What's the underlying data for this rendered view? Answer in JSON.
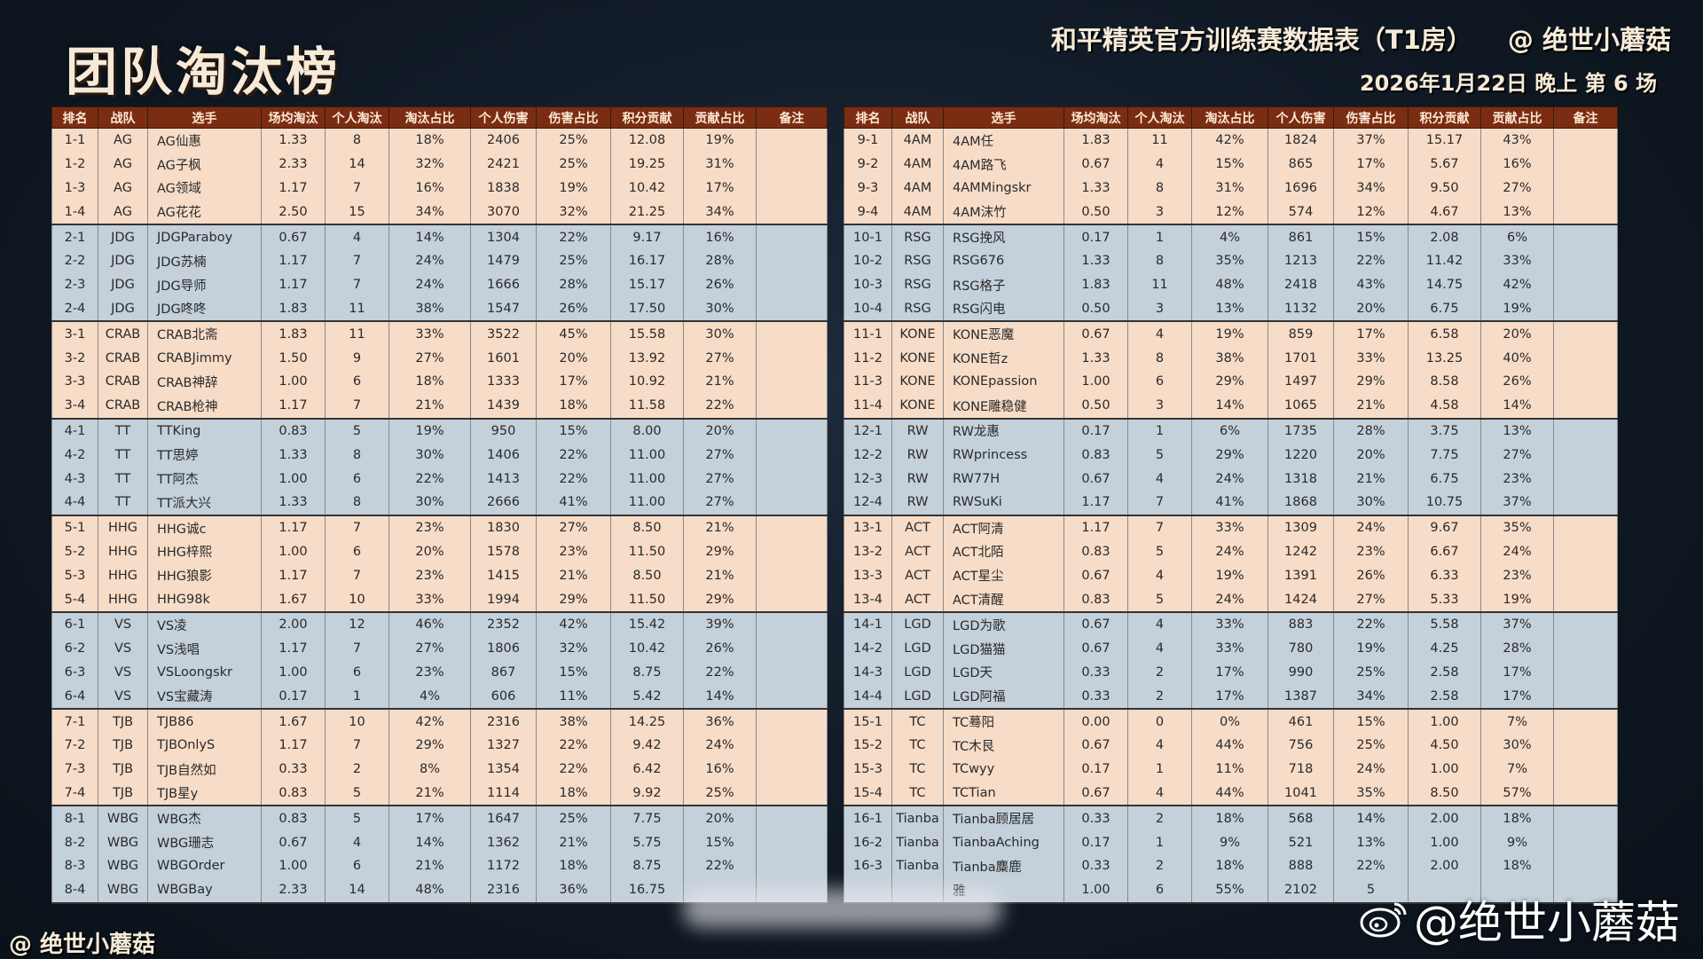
{
  "header": {
    "page_title": "团队淘汰榜",
    "sheet_title": "和平精英官方训练赛数据表（T1房）",
    "handle": "@ 绝世小蘑菇",
    "session_info": "2026年1月22日 晚上 第 6 场"
  },
  "columns": [
    "排名",
    "战队",
    "选手",
    "场均淘汰",
    "个人淘汰",
    "淘汰占比",
    "个人伤害",
    "伤害占比",
    "积分贡献",
    "贡献占比",
    "备注"
  ],
  "left_rows": [
    [
      "1-1",
      "AG",
      "AG仙惠",
      "1.33",
      "8",
      "18%",
      "2406",
      "25%",
      "12.08",
      "19%",
      ""
    ],
    [
      "1-2",
      "AG",
      "AG子枫",
      "2.33",
      "14",
      "32%",
      "2421",
      "25%",
      "19.25",
      "31%",
      ""
    ],
    [
      "1-3",
      "AG",
      "AG领域",
      "1.17",
      "7",
      "16%",
      "1838",
      "19%",
      "10.42",
      "17%",
      ""
    ],
    [
      "1-4",
      "AG",
      "AG花花",
      "2.50",
      "15",
      "34%",
      "3070",
      "32%",
      "21.25",
      "34%",
      ""
    ],
    [
      "2-1",
      "JDG",
      "JDGParaboy",
      "0.67",
      "4",
      "14%",
      "1304",
      "22%",
      "9.17",
      "16%",
      ""
    ],
    [
      "2-2",
      "JDG",
      "JDG苏楠",
      "1.17",
      "7",
      "24%",
      "1479",
      "25%",
      "16.17",
      "28%",
      ""
    ],
    [
      "2-3",
      "JDG",
      "JDG导师",
      "1.17",
      "7",
      "24%",
      "1666",
      "28%",
      "15.17",
      "26%",
      ""
    ],
    [
      "2-4",
      "JDG",
      "JDG咚咚",
      "1.83",
      "11",
      "38%",
      "1547",
      "26%",
      "17.50",
      "30%",
      ""
    ],
    [
      "3-1",
      "CRAB",
      "CRAB北斋",
      "1.83",
      "11",
      "33%",
      "3522",
      "45%",
      "15.58",
      "30%",
      ""
    ],
    [
      "3-2",
      "CRAB",
      "CRABJimmy",
      "1.50",
      "9",
      "27%",
      "1601",
      "20%",
      "13.92",
      "27%",
      ""
    ],
    [
      "3-3",
      "CRAB",
      "CRAB神辞",
      "1.00",
      "6",
      "18%",
      "1333",
      "17%",
      "10.92",
      "21%",
      ""
    ],
    [
      "3-4",
      "CRAB",
      "CRAB枪神",
      "1.17",
      "7",
      "21%",
      "1439",
      "18%",
      "11.58",
      "22%",
      ""
    ],
    [
      "4-1",
      "TT",
      "TTKing",
      "0.83",
      "5",
      "19%",
      "950",
      "15%",
      "8.00",
      "20%",
      ""
    ],
    [
      "4-2",
      "TT",
      "TT思婷",
      "1.33",
      "8",
      "30%",
      "1406",
      "22%",
      "11.00",
      "27%",
      ""
    ],
    [
      "4-3",
      "TT",
      "TT阿杰",
      "1.00",
      "6",
      "22%",
      "1413",
      "22%",
      "11.00",
      "27%",
      ""
    ],
    [
      "4-4",
      "TT",
      "TT派大兴",
      "1.33",
      "8",
      "30%",
      "2666",
      "41%",
      "11.00",
      "27%",
      ""
    ],
    [
      "5-1",
      "HHG",
      "HHG诚c",
      "1.17",
      "7",
      "23%",
      "1830",
      "27%",
      "8.50",
      "21%",
      ""
    ],
    [
      "5-2",
      "HHG",
      "HHG梓熙",
      "1.00",
      "6",
      "20%",
      "1578",
      "23%",
      "11.50",
      "29%",
      ""
    ],
    [
      "5-3",
      "HHG",
      "HHG狼影",
      "1.17",
      "7",
      "23%",
      "1415",
      "21%",
      "8.50",
      "21%",
      ""
    ],
    [
      "5-4",
      "HHG",
      "HHG98k",
      "1.67",
      "10",
      "33%",
      "1994",
      "29%",
      "11.50",
      "29%",
      ""
    ],
    [
      "6-1",
      "VS",
      "VS凌",
      "2.00",
      "12",
      "46%",
      "2352",
      "42%",
      "15.42",
      "39%",
      ""
    ],
    [
      "6-2",
      "VS",
      "VS浅唱",
      "1.17",
      "7",
      "27%",
      "1806",
      "32%",
      "10.42",
      "26%",
      ""
    ],
    [
      "6-3",
      "VS",
      "VSLoongskr",
      "1.00",
      "6",
      "23%",
      "867",
      "15%",
      "8.75",
      "22%",
      ""
    ],
    [
      "6-4",
      "VS",
      "VS宝藏涛",
      "0.17",
      "1",
      "4%",
      "606",
      "11%",
      "5.42",
      "14%",
      ""
    ],
    [
      "7-1",
      "TJB",
      "TJB86",
      "1.67",
      "10",
      "42%",
      "2316",
      "38%",
      "14.25",
      "36%",
      ""
    ],
    [
      "7-2",
      "TJB",
      "TJBOnlyS",
      "1.17",
      "7",
      "29%",
      "1327",
      "22%",
      "9.42",
      "24%",
      ""
    ],
    [
      "7-3",
      "TJB",
      "TJB自然如",
      "0.33",
      "2",
      "8%",
      "1354",
      "22%",
      "6.42",
      "16%",
      ""
    ],
    [
      "7-4",
      "TJB",
      "TJB星y",
      "0.83",
      "5",
      "21%",
      "1114",
      "18%",
      "9.92",
      "25%",
      ""
    ],
    [
      "8-1",
      "WBG",
      "WBG杰",
      "0.83",
      "5",
      "17%",
      "1647",
      "25%",
      "7.75",
      "20%",
      ""
    ],
    [
      "8-2",
      "WBG",
      "WBG珊志",
      "0.67",
      "4",
      "14%",
      "1362",
      "21%",
      "5.75",
      "15%",
      ""
    ],
    [
      "8-3",
      "WBG",
      "WBGOrder",
      "1.00",
      "6",
      "21%",
      "1172",
      "18%",
      "8.75",
      "22%",
      ""
    ],
    [
      "8-4",
      "WBG",
      "WBGBay",
      "2.33",
      "14",
      "48%",
      "2316",
      "36%",
      "16.75",
      "",
      ""
    ]
  ],
  "right_rows": [
    [
      "9-1",
      "4AM",
      "4AM任",
      "1.83",
      "11",
      "42%",
      "1824",
      "37%",
      "15.17",
      "43%",
      ""
    ],
    [
      "9-2",
      "4AM",
      "4AM路飞",
      "0.67",
      "4",
      "15%",
      "865",
      "17%",
      "5.67",
      "16%",
      ""
    ],
    [
      "9-3",
      "4AM",
      "4AMMingskr",
      "1.33",
      "8",
      "31%",
      "1696",
      "34%",
      "9.50",
      "27%",
      ""
    ],
    [
      "9-4",
      "4AM",
      "4AM沫竹",
      "0.50",
      "3",
      "12%",
      "574",
      "12%",
      "4.67",
      "13%",
      ""
    ],
    [
      "10-1",
      "RSG",
      "RSG挽风",
      "0.17",
      "1",
      "4%",
      "861",
      "15%",
      "2.08",
      "6%",
      ""
    ],
    [
      "10-2",
      "RSG",
      "RSG676",
      "1.33",
      "8",
      "35%",
      "1213",
      "22%",
      "11.42",
      "33%",
      ""
    ],
    [
      "10-3",
      "RSG",
      "RSG格子",
      "1.83",
      "11",
      "48%",
      "2418",
      "43%",
      "14.75",
      "42%",
      ""
    ],
    [
      "10-4",
      "RSG",
      "RSG闪电",
      "0.50",
      "3",
      "13%",
      "1132",
      "20%",
      "6.75",
      "19%",
      ""
    ],
    [
      "11-1",
      "KONE",
      "KONE恶魔",
      "0.67",
      "4",
      "19%",
      "859",
      "17%",
      "6.58",
      "20%",
      ""
    ],
    [
      "11-2",
      "KONE",
      "KONE哲z",
      "1.33",
      "8",
      "38%",
      "1701",
      "33%",
      "13.25",
      "40%",
      ""
    ],
    [
      "11-3",
      "KONE",
      "KONEpassion",
      "1.00",
      "6",
      "29%",
      "1497",
      "29%",
      "8.58",
      "26%",
      ""
    ],
    [
      "11-4",
      "KONE",
      "KONE雕稳健",
      "0.50",
      "3",
      "14%",
      "1065",
      "21%",
      "4.58",
      "14%",
      ""
    ],
    [
      "12-1",
      "RW",
      "RW龙惠",
      "0.17",
      "1",
      "6%",
      "1735",
      "28%",
      "3.75",
      "13%",
      ""
    ],
    [
      "12-2",
      "RW",
      "RWprincess",
      "0.83",
      "5",
      "29%",
      "1220",
      "20%",
      "7.75",
      "27%",
      ""
    ],
    [
      "12-3",
      "RW",
      "RW77H",
      "0.67",
      "4",
      "24%",
      "1318",
      "21%",
      "6.75",
      "23%",
      ""
    ],
    [
      "12-4",
      "RW",
      "RWSuKi",
      "1.17",
      "7",
      "41%",
      "1868",
      "30%",
      "10.75",
      "37%",
      ""
    ],
    [
      "13-1",
      "ACT",
      "ACT阿清",
      "1.17",
      "7",
      "33%",
      "1309",
      "24%",
      "9.67",
      "35%",
      ""
    ],
    [
      "13-2",
      "ACT",
      "ACT北陌",
      "0.83",
      "5",
      "24%",
      "1242",
      "23%",
      "6.67",
      "24%",
      ""
    ],
    [
      "13-3",
      "ACT",
      "ACT星尘",
      "0.67",
      "4",
      "19%",
      "1391",
      "26%",
      "6.33",
      "23%",
      ""
    ],
    [
      "13-4",
      "ACT",
      "ACT清醒",
      "0.83",
      "5",
      "24%",
      "1424",
      "27%",
      "5.33",
      "19%",
      ""
    ],
    [
      "14-1",
      "LGD",
      "LGD为歌",
      "0.67",
      "4",
      "33%",
      "883",
      "22%",
      "5.58",
      "37%",
      ""
    ],
    [
      "14-2",
      "LGD",
      "LGD猫猫",
      "0.67",
      "4",
      "33%",
      "780",
      "19%",
      "4.25",
      "28%",
      ""
    ],
    [
      "14-3",
      "LGD",
      "LGD天",
      "0.33",
      "2",
      "17%",
      "990",
      "25%",
      "2.58",
      "17%",
      ""
    ],
    [
      "14-4",
      "LGD",
      "LGD阿福",
      "0.33",
      "2",
      "17%",
      "1387",
      "34%",
      "2.58",
      "17%",
      ""
    ],
    [
      "15-1",
      "TC",
      "TC蓦阳",
      "0.00",
      "0",
      "0%",
      "461",
      "15%",
      "1.00",
      "7%",
      ""
    ],
    [
      "15-2",
      "TC",
      "TC木艮",
      "0.67",
      "4",
      "44%",
      "756",
      "25%",
      "4.50",
      "30%",
      ""
    ],
    [
      "15-3",
      "TC",
      "TCwyy",
      "0.17",
      "1",
      "11%",
      "718",
      "24%",
      "1.00",
      "7%",
      ""
    ],
    [
      "15-4",
      "TC",
      "TCTian",
      "0.67",
      "4",
      "44%",
      "1041",
      "35%",
      "8.50",
      "57%",
      ""
    ],
    [
      "16-1",
      "Tianba",
      "Tianba顾居居",
      "0.33",
      "2",
      "18%",
      "568",
      "14%",
      "2.00",
      "18%",
      ""
    ],
    [
      "16-2",
      "Tianba",
      "TianbaAching",
      "0.17",
      "1",
      "9%",
      "521",
      "13%",
      "1.00",
      "9%",
      ""
    ],
    [
      "16-3",
      "Tianba",
      "Tianba麋鹿",
      "0.33",
      "2",
      "18%",
      "888",
      "22%",
      "2.00",
      "18%",
      ""
    ],
    [
      "",
      "",
      "雅",
      "1.00",
      "6",
      "55%",
      "2102",
      "5",
      "",
      "",
      ""
    ]
  ],
  "watermarks": {
    "footer": "@ 绝世小蘑菇",
    "weibo": "@绝世小蘑菇"
  },
  "colors": {
    "header_bg": "#7a2d12",
    "row_peach": "#f7dcc7",
    "row_blue": "#c4d0da",
    "background": "#121c27"
  }
}
